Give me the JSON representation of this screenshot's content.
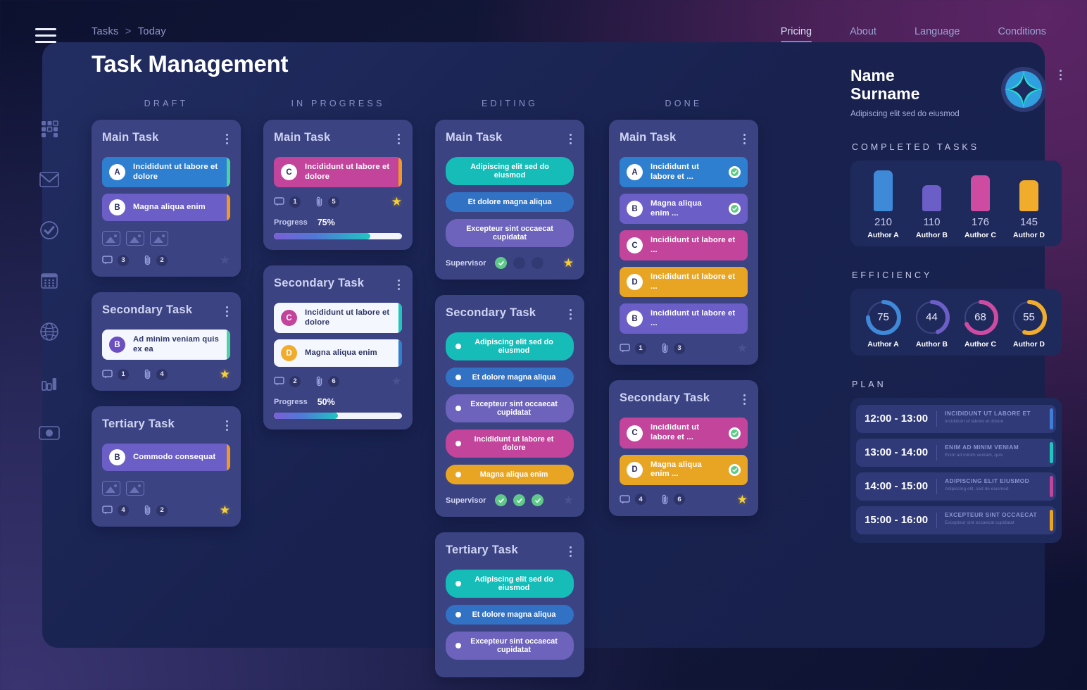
{
  "header": {
    "breadcrumb": {
      "root": "Tasks",
      "sep": ">",
      "current": "Today"
    },
    "title": "Task Management",
    "nav": [
      {
        "label": "Pricing",
        "active": true
      },
      {
        "label": "About",
        "active": false
      },
      {
        "label": "Language",
        "active": false
      },
      {
        "label": "Conditions",
        "active": false
      }
    ]
  },
  "rail": [
    {
      "name": "grid-icon"
    },
    {
      "name": "mail-icon"
    },
    {
      "name": "check-circle-icon"
    },
    {
      "name": "calendar-icon"
    },
    {
      "name": "globe-icon"
    },
    {
      "name": "bar-chart-icon"
    },
    {
      "name": "toggle-icon"
    }
  ],
  "board": {
    "columns": [
      {
        "header": "DRAFT",
        "cards": [
          {
            "title": "Main Task",
            "rows": [
              {
                "avatar": "A",
                "text": "Incididunt ut labore et dolore",
                "bg": "#2f7fd0",
                "edge": "#4ad3a2"
              },
              {
                "avatar": "B",
                "text": "Magna aliqua enim",
                "bg": "#6b5ec6",
                "edge": "#ef9a22"
              }
            ],
            "thumbs": 3,
            "comments": "3",
            "attachments": "2",
            "starred": false
          },
          {
            "title": "Secondary Task",
            "rows": [
              {
                "avatar": "B",
                "text": "Ad minim veniam  quis ex ea",
                "bg": "#f4f7fd",
                "edge": "#4ad3a2",
                "light": true,
                "avatarBg": "#6b4fc0",
                "avatarFg": "#ffffff"
              }
            ],
            "thumbs": 0,
            "comments": "1",
            "attachments": "4",
            "starred": true
          },
          {
            "title": "Tertiary Task",
            "rows": [
              {
                "avatar": "B",
                "text": "Commodo consequat",
                "bg": "#6b5ec6",
                "edge": "#ef9a22"
              }
            ],
            "thumbs": 2,
            "comments": "4",
            "attachments": "2",
            "starred": true
          }
        ]
      },
      {
        "header": "IN PROGRESS",
        "cards": [
          {
            "title": "Main Task",
            "rows": [
              {
                "avatar": "C",
                "text": "Incididunt ut labore et dolore",
                "bg": "#c2449b",
                "edge": "#ef9a22"
              }
            ],
            "thumbs": 0,
            "comments": "1",
            "attachments": "5",
            "starred": true,
            "progress_label": "Progress",
            "progress_value": "75%",
            "progress_pct": 75
          },
          {
            "title": "Secondary Task",
            "rows": [
              {
                "avatar": "C",
                "text": "Incididunt ut labore et dolore",
                "bg": "#f4f7fd",
                "edge": "#1fc6c0",
                "light": true,
                "avatarBg": "#c2449b",
                "avatarFg": "#ffffff"
              },
              {
                "avatar": "D",
                "text": "Magna aliqua enim",
                "bg": "#f4f7fd",
                "edge": "#2f7fd0",
                "light": true,
                "avatarBg": "#f0ac2a",
                "avatarFg": "#ffffff"
              }
            ],
            "thumbs": 0,
            "comments": "2",
            "attachments": "6",
            "starred": false,
            "progress_label": "Progress",
            "progress_value": "50%",
            "progress_pct": 50
          }
        ]
      },
      {
        "header": "EDITING",
        "cards": [
          {
            "title": "Main Task",
            "chips": [
              {
                "text": "Adipiscing elit sed do eiusmod",
                "bg": "#16bdb8",
                "dot": false
              },
              {
                "text": "Et dolore magna aliqua",
                "bg": "#3272c4",
                "dot": false
              },
              {
                "text": "Excepteur sint occaecat cupidatat",
                "bg": "#6d63bc",
                "dot": false
              }
            ],
            "supervisor_label": "Supervisor",
            "supervisor": [
              true,
              false,
              false
            ],
            "starred": true
          },
          {
            "title": "Secondary Task",
            "chips": [
              {
                "text": "Adipiscing elit sed do eiusmod",
                "bg": "#16bdb8",
                "dot": true
              },
              {
                "text": "Et dolore magna aliqua",
                "bg": "#3272c4",
                "dot": true
              },
              {
                "text": "Excepteur sint occaecat cupidatat",
                "bg": "#6d63bc",
                "dot": true
              },
              {
                "text": "Incididunt ut labore et dolore",
                "bg": "#c2449b",
                "dot": true
              },
              {
                "text": "Magna aliqua enim",
                "bg": "#e8a524",
                "dot": true
              }
            ],
            "supervisor_label": "Supervisor",
            "supervisor": [
              true,
              true,
              true
            ],
            "starred": false
          },
          {
            "title": "Tertiary Task",
            "chips": [
              {
                "text": "Adipiscing elit sed do eiusmod",
                "bg": "#16bdb8",
                "dot": true
              },
              {
                "text": "Et dolore magna aliqua",
                "bg": "#3272c4",
                "dot": true
              },
              {
                "text": "Excepteur sint occaecat cupidatat",
                "bg": "#6d63bc",
                "dot": true
              }
            ]
          }
        ]
      },
      {
        "header": "DONE",
        "cards": [
          {
            "title": "Main Task",
            "rows": [
              {
                "avatar": "A",
                "text": "Incididunt ut labore et ...",
                "bg": "#2f7fd0",
                "tick": true
              },
              {
                "avatar": "B",
                "text": "Magna aliqua enim ...",
                "bg": "#6b5ec6",
                "tick": true
              },
              {
                "avatar": "C",
                "text": "Incididunt ut labore et ...",
                "bg": "#c2449b",
                "tick": false
              },
              {
                "avatar": "D",
                "text": "Incididunt ut labore et ...",
                "bg": "#e8a524",
                "tick": false
              },
              {
                "avatar": "B",
                "text": "Incididunt ut labore et ...",
                "bg": "#6b5ec6",
                "tick": false
              }
            ],
            "thumbs": 0,
            "comments": "1",
            "attachments": "3",
            "starred": false
          },
          {
            "title": "Secondary Task",
            "rows": [
              {
                "avatar": "C",
                "text": "Incididunt ut labore et ...",
                "bg": "#c2449b",
                "tick": true
              },
              {
                "avatar": "D",
                "text": "Magna aliqua enim ...",
                "bg": "#e8a524",
                "tick": true
              }
            ],
            "thumbs": 0,
            "comments": "4",
            "attachments": "6",
            "starred": true
          }
        ]
      }
    ]
  },
  "sidebar": {
    "profile": {
      "name_line1": "Name",
      "name_line2": "Surname",
      "subtitle": "Adipiscing elit sed do eiusmod"
    },
    "completed_title": "COMPLETED TASKS",
    "efficiency_title": "EFFICIENCY",
    "plan_title": "PLAN",
    "plan": [
      {
        "time": "12:00 - 13:00",
        "heading": "INCIDIDUNT UT LABORE ET",
        "sub": "Incididunt ut labore et dolore",
        "color": "#3f7ed6"
      },
      {
        "time": "13:00 - 14:00",
        "heading": "ENIM AD MINIM VENIAM",
        "sub": "Enim ad minim veniam, quis",
        "color": "#1fc6c0"
      },
      {
        "time": "14:00 - 15:00",
        "heading": "ADIPISCING ELIT EIUSMOD",
        "sub": "Adipiscing elit, sed do eiusmod",
        "color": "#c2449b"
      },
      {
        "time": "15:00 - 16:00",
        "heading": "EXCEPTEUR SINT OCCAECAT",
        "sub": "Excepteur sint occaecat cupidatat",
        "color": "#e8a524"
      }
    ]
  },
  "chart_data": [
    {
      "type": "bar",
      "title": "COMPLETED TASKS",
      "categories": [
        "Author A",
        "Author B",
        "Author C",
        "Author D"
      ],
      "values": [
        210,
        110,
        176,
        145
      ],
      "colors": [
        "#3f8ad8",
        "#6b5ec6",
        "#cd4ba0",
        "#f0ac2a"
      ],
      "xlabel": "",
      "ylabel": "",
      "ylim": [
        0,
        210
      ],
      "grid": false,
      "legend": "none"
    },
    {
      "type": "pie",
      "title": "EFFICIENCY",
      "categories": [
        "Author A",
        "Author B",
        "Author C",
        "Author D"
      ],
      "values": [
        75,
        44,
        68,
        55
      ],
      "colors": [
        "#3f8ad8",
        "#6b5ec6",
        "#cd4ba0",
        "#f0ac2a"
      ],
      "unit": "%",
      "note": "four donut gauges, track color #3c4480, max 100",
      "legend": "below each gauge"
    }
  ]
}
